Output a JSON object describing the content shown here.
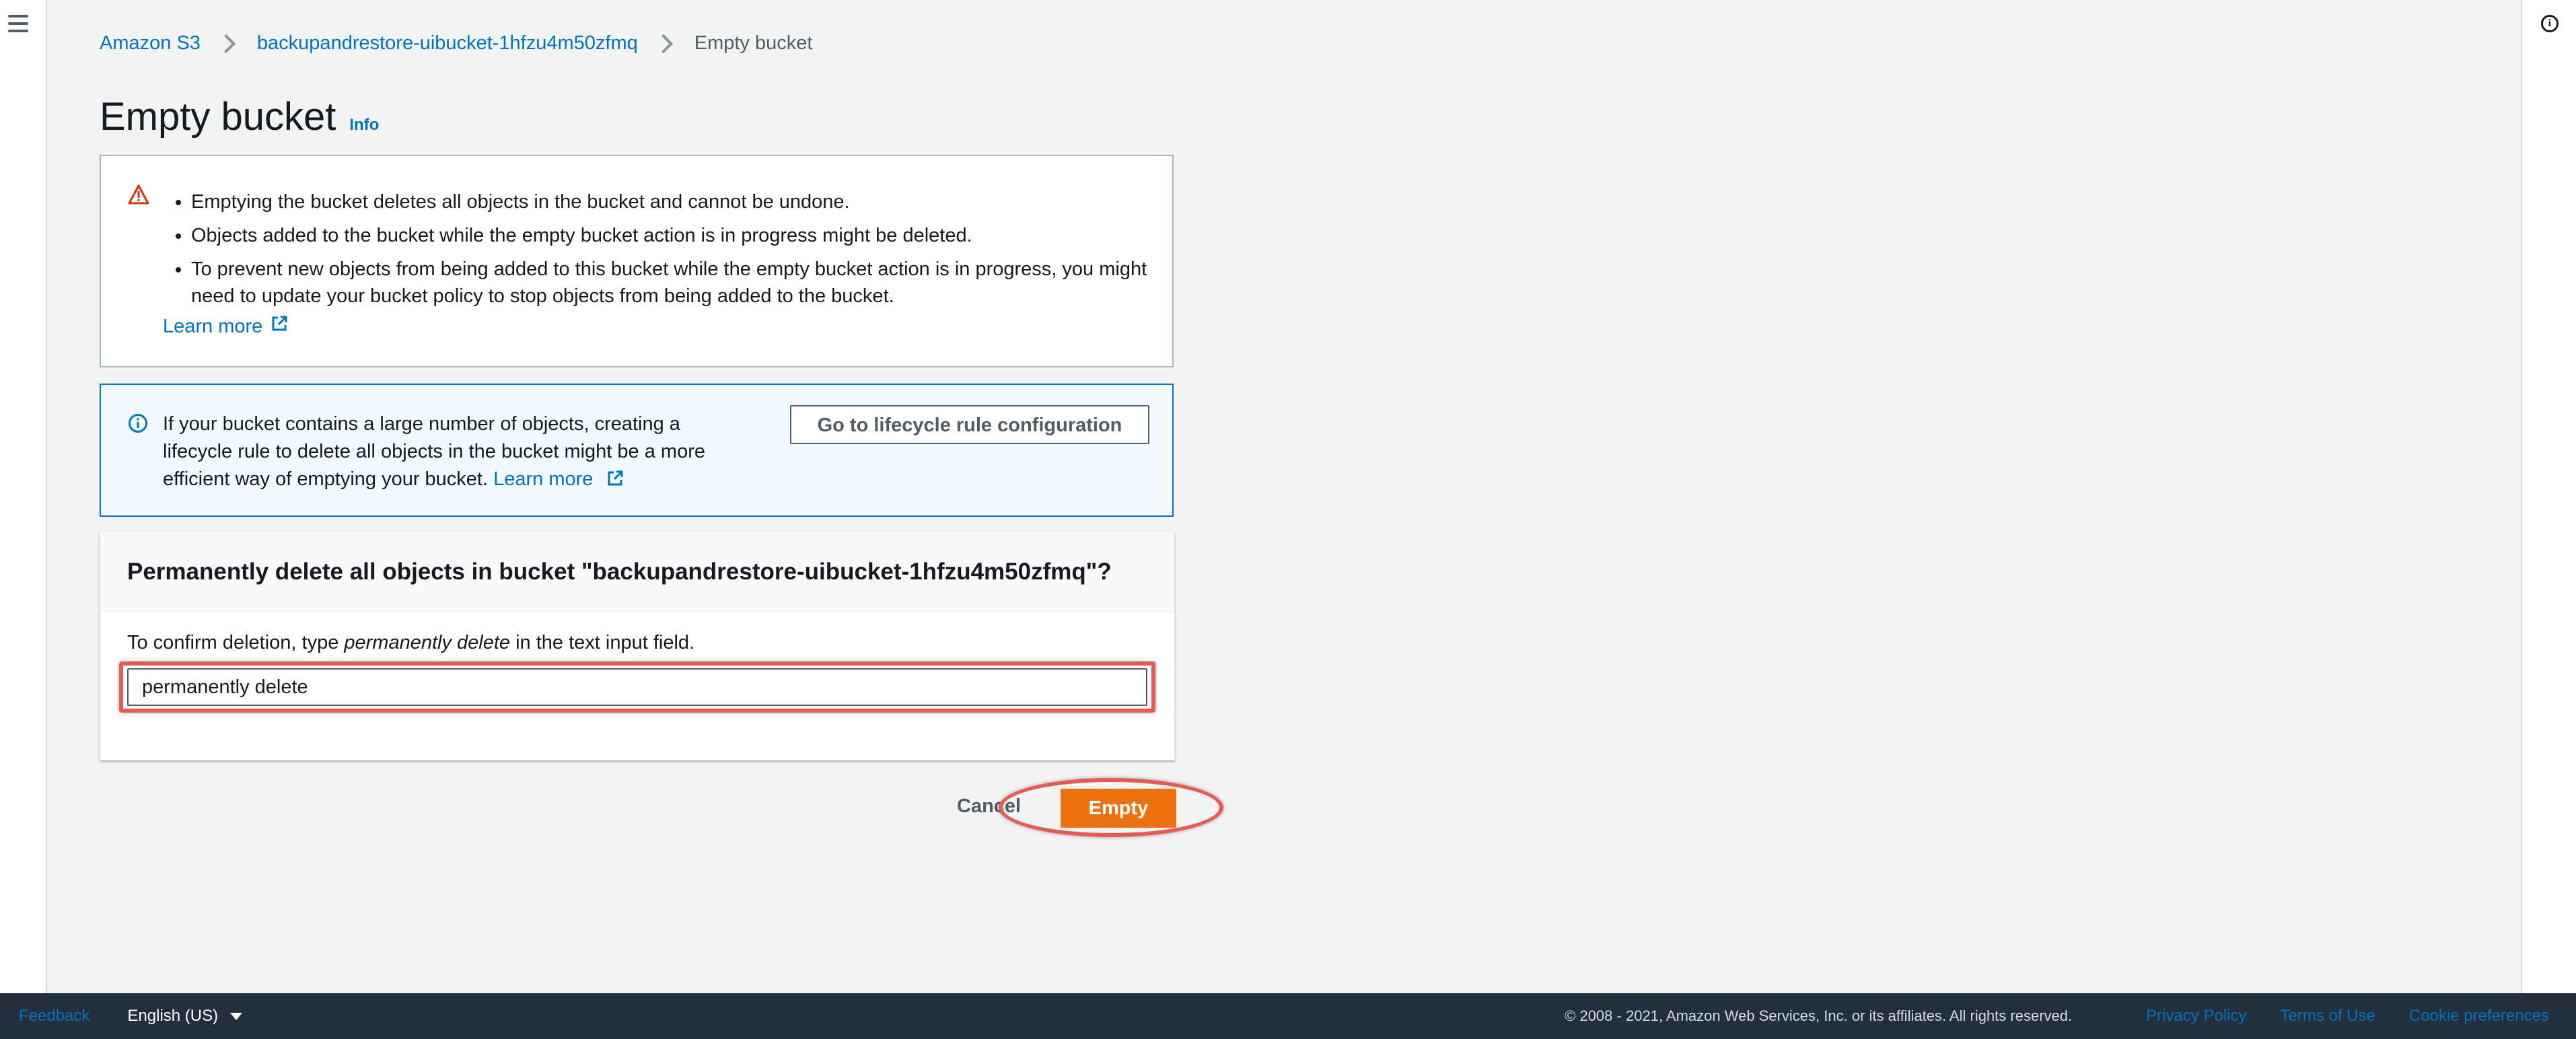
{
  "breadcrumb": {
    "items": [
      "Amazon S3",
      "backupandrestore-uibucket-1hfzu4m50zfmq"
    ],
    "current": "Empty bucket"
  },
  "page": {
    "title": "Empty bucket",
    "info_link": "Info"
  },
  "warning": {
    "icon": "warning-triangle-icon",
    "items": [
      "Emptying the bucket deletes all objects in the bucket and cannot be undone.",
      "Objects added to the bucket while the empty bucket action is in progress might be deleted.",
      "To prevent new objects from being added to this bucket while the empty bucket action is in progress, you might need to update your bucket policy to stop objects from being added to the bucket."
    ],
    "learn_more": "Learn more"
  },
  "info": {
    "icon": "info-icon",
    "text": "If your bucket contains a large number of objects, creating a lifecycle rule to delete all objects in the bucket might be a more efficient way of emptying your bucket.",
    "learn_more": "Learn more",
    "button": "Go to lifecycle rule configuration"
  },
  "confirm": {
    "title": "Permanently delete all objects in bucket \"backupandrestore-uibucket-1hfzu4m50zfmq\"?",
    "desc_prefix": "To confirm deletion, type ",
    "desc_emphasis": "permanently delete",
    "desc_suffix": " in the text input field.",
    "input_value": "permanently delete"
  },
  "actions": {
    "cancel": "Cancel",
    "empty": "Empty"
  },
  "footer": {
    "feedback": "Feedback",
    "language": "English (US)",
    "copyright": "© 2008 - 2021, Amazon Web Services, Inc. or its affiliates. All rights reserved.",
    "privacy": "Privacy Policy",
    "terms": "Terms of Use",
    "cookies": "Cookie preferences"
  },
  "colors": {
    "accent": "#ec7211",
    "link": "#0073bb",
    "highlight": "#e45b52",
    "footer_bg": "#232f3e"
  }
}
